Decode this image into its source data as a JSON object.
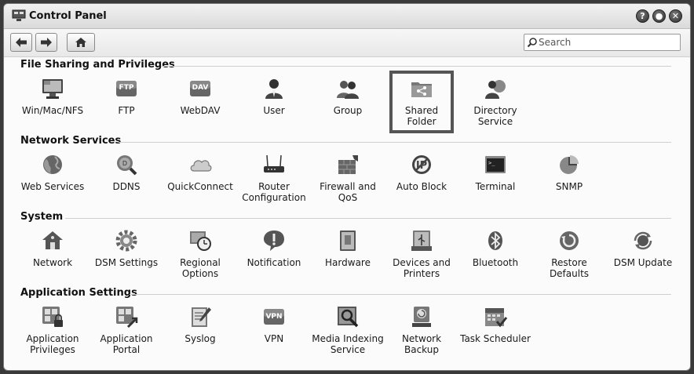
{
  "window": {
    "title": "Control Panel"
  },
  "window_buttons": [
    "?",
    "●",
    "✕"
  ],
  "search": {
    "placeholder": "Search",
    "value": ""
  },
  "sections": [
    {
      "title": "File Sharing and Privileges",
      "items": [
        {
          "label": "Win/Mac/NFS",
          "icon": "monitor-icon"
        },
        {
          "label": "FTP",
          "icon": "ftp-icon"
        },
        {
          "label": "WebDAV",
          "icon": "dav-icon"
        },
        {
          "label": "User",
          "icon": "user-icon"
        },
        {
          "label": "Group",
          "icon": "group-icon"
        },
        {
          "label": "Shared Folder",
          "icon": "shared-folder-icon",
          "selected": true
        },
        {
          "label": "Directory Service",
          "icon": "directory-service-icon"
        }
      ]
    },
    {
      "title": "Network Services",
      "items": [
        {
          "label": "Web Services",
          "icon": "globe-icon"
        },
        {
          "label": "DDNS",
          "icon": "ddns-icon"
        },
        {
          "label": "QuickConnect",
          "icon": "cloud-icon"
        },
        {
          "label": "Router Configuration",
          "icon": "router-icon"
        },
        {
          "label": "Firewall and QoS",
          "icon": "firewall-icon"
        },
        {
          "label": "Auto Block",
          "icon": "auto-block-icon"
        },
        {
          "label": "Terminal",
          "icon": "terminal-icon"
        },
        {
          "label": "SNMP",
          "icon": "pie-chart-icon"
        }
      ]
    },
    {
      "title": "System",
      "items": [
        {
          "label": "Network",
          "icon": "house-network-icon"
        },
        {
          "label": "DSM Settings",
          "icon": "gear-icon"
        },
        {
          "label": "Regional Options",
          "icon": "clock-icon"
        },
        {
          "label": "Notification",
          "icon": "notification-icon"
        },
        {
          "label": "Hardware",
          "icon": "hardware-icon"
        },
        {
          "label": "Devices and Printers",
          "icon": "usb-icon"
        },
        {
          "label": "Bluetooth",
          "icon": "bluetooth-icon"
        },
        {
          "label": "Restore Defaults",
          "icon": "restore-icon"
        },
        {
          "label": "DSM Update",
          "icon": "update-icon"
        }
      ]
    },
    {
      "title": "Application Settings",
      "items": [
        {
          "label": "Application Privileges",
          "icon": "app-privileges-icon"
        },
        {
          "label": "Application Portal",
          "icon": "app-portal-icon"
        },
        {
          "label": "Syslog",
          "icon": "syslog-icon"
        },
        {
          "label": "VPN",
          "icon": "vpn-icon"
        },
        {
          "label": "Media Indexing Service",
          "icon": "media-index-icon"
        },
        {
          "label": "Network Backup",
          "icon": "network-backup-icon"
        },
        {
          "label": "Task Scheduler",
          "icon": "calendar-icon"
        }
      ]
    }
  ]
}
